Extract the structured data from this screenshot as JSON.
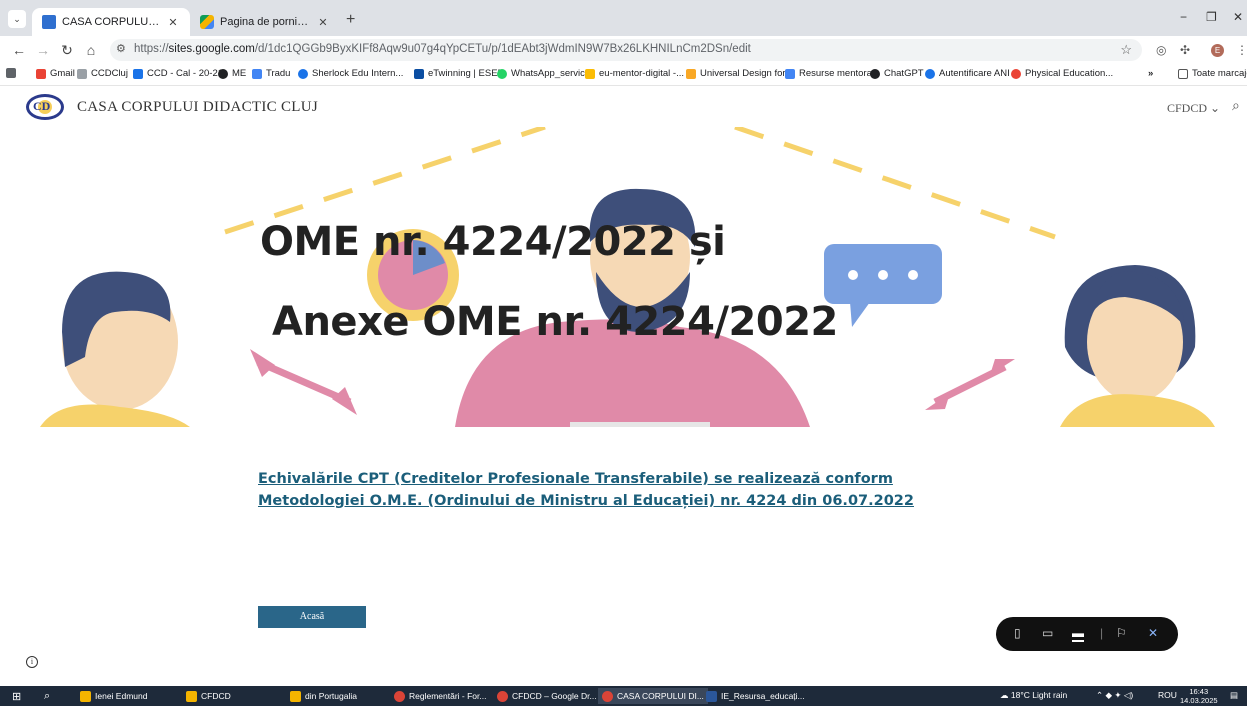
{
  "browser": {
    "tabs": [
      {
        "title": "CASA CORPULUI DIDACTIC CLUJ",
        "icon": "sites-icon",
        "active": true
      },
      {
        "title": "Pagina de pornire – Google Drive",
        "icon": "drive-icon",
        "active": false
      }
    ],
    "url_prefix": "https://",
    "url_host": "sites.google.com",
    "url_path": "/d/1dc1QGGb9ByxKIFf8Aqw9u07g4qYpCETu/p/1dEAbt3jWdmIN9W7Bx26LKHNILnCm2DSn/edit",
    "bookmarks": [
      {
        "label": "Gmail",
        "color": "#ea4335"
      },
      {
        "label": "CCDCluj",
        "color": "#9aa0a6"
      },
      {
        "label": "CCD - Cal - 20-21",
        "color": "#1a73e8"
      },
      {
        "label": "ME",
        "color": "#202124"
      },
      {
        "label": "Tradu",
        "color": "#4285f4"
      },
      {
        "label": "Sherlock Edu Intern...",
        "color": "#1a73e8"
      },
      {
        "label": "eTwinning | ESEP",
        "color": "#0b4ea2"
      },
      {
        "label": "WhatsApp_serviciu",
        "color": "#25d366"
      },
      {
        "label": "eu-mentor-digital -...",
        "color": "#fbbc04"
      },
      {
        "label": "Universal Design for...",
        "color": "#f9a825"
      },
      {
        "label": "Resurse mentorat",
        "color": "#4285f4"
      },
      {
        "label": "ChatGPT",
        "color": "#202124"
      },
      {
        "label": "Autentificare ANI",
        "color": "#1a73e8"
      },
      {
        "label": "Physical Education...",
        "color": "#ea4335"
      }
    ],
    "bookmarks_more": "»",
    "all_bookmarks": "Toate marcajele"
  },
  "site": {
    "title": "CASA CORPULUI DIDACTIC CLUJ",
    "logo_text": "CD",
    "nav_label": "CFDCD ⌄",
    "hero_line1": "OME nr. 4224/2022 și",
    "hero_line2": "Anexe OME nr. 4224/2022",
    "link_text": "Echivalările CPT (Creditelor Profesionale Transferabile) se realizează conform  Metodologiei O.M.E. (Ordinului de Ministru al Educației) nr. 4224 din 06.07.2022",
    "home_button": "Acasă"
  },
  "taskbar": {
    "items": [
      {
        "label": "Ienei Edmund",
        "color": "#f4b400",
        "active": false
      },
      {
        "label": "CFDCD",
        "color": "#f4b400",
        "active": false
      },
      {
        "label": "din Portugalia",
        "color": "#f4b400",
        "active": false
      },
      {
        "label": "Reglementări - For...",
        "color": "#db4437",
        "active": false
      },
      {
        "label": "CFDCD – Google Dr...",
        "color": "#db4437",
        "active": false
      },
      {
        "label": "CASA CORPULUI DI...",
        "color": "#db4437",
        "active": true
      },
      {
        "label": "IE_Resursa_educați...",
        "color": "#2b579a",
        "active": false
      }
    ],
    "weather": "18°C  Light rain",
    "lang": "ROU",
    "time": "16:43",
    "date": "14.03.2025"
  }
}
